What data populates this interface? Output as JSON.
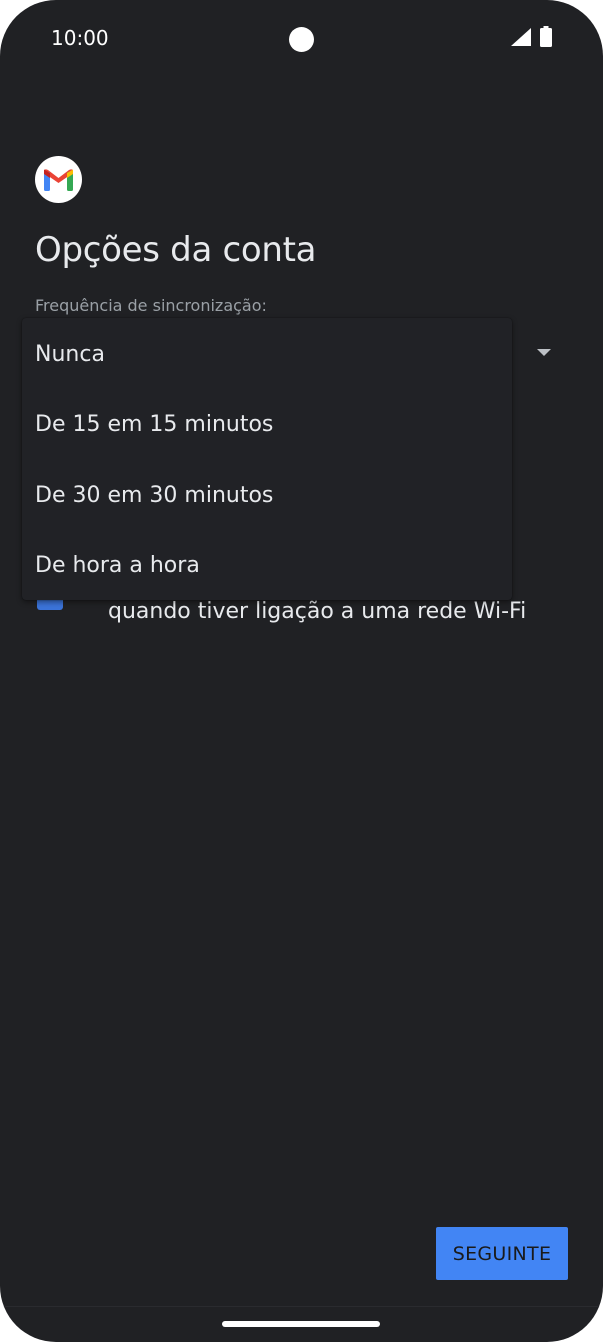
{
  "status_bar": {
    "time": "10:00",
    "signal_icon": "signal-icon",
    "battery_icon": "battery-icon"
  },
  "header": {
    "logo_icon": "gmail-logo-icon",
    "title": "Opções da conta"
  },
  "sync": {
    "label": "Frequência de sincronização:",
    "dropdown_open": true,
    "options": [
      "Nunca",
      "De 15 em 15 minutos",
      "De 30 em 30 minutos",
      "De hora a hora"
    ]
  },
  "wifi_option": {
    "checked": true,
    "label": "quando tiver ligação a uma rede Wi-Fi"
  },
  "footer": {
    "next_label": "SEGUINTE"
  },
  "colors": {
    "background": "#202124",
    "accent": "#4285f4",
    "text": "#e8eaed"
  }
}
